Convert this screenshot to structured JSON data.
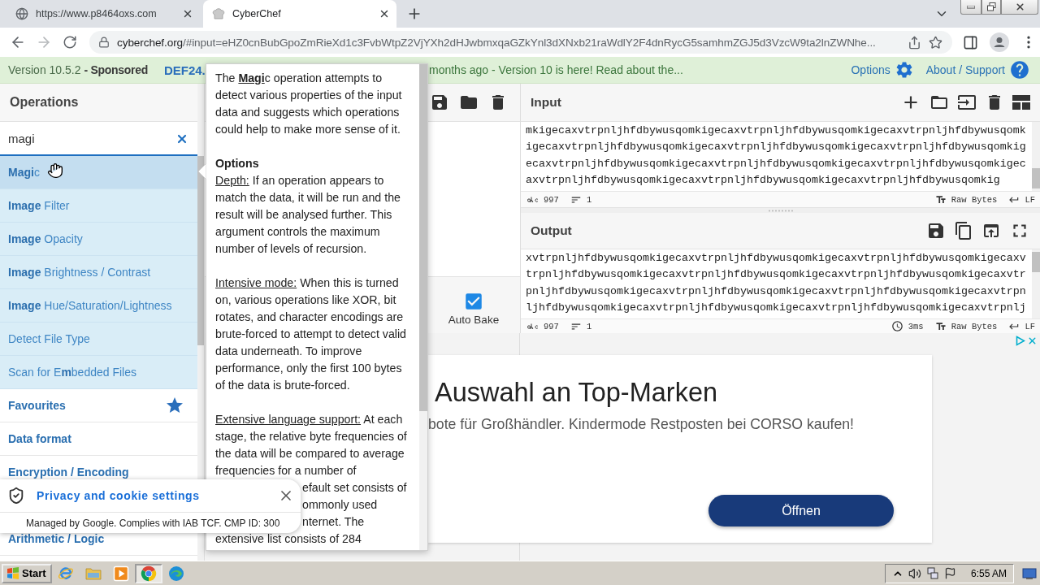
{
  "browser": {
    "tabs": [
      {
        "title": "https://www.p8464oxs.com",
        "selected": false
      },
      {
        "title": "CyberChef",
        "selected": true
      }
    ],
    "address": {
      "host": "cyberchef.org",
      "path": "/#input=eHZ0cnBubGpoZmRieXd1c3FvbWtpZ2VjYXh2dHJwbmxqaGZkYnl3dXNxb21raWdlY2F4dnRycG5samhmZGJ5d3VzcW9ta2lnZWNhe..."
    }
  },
  "banner": {
    "version": "Version 10.5.2",
    "sponsored": "- Sponsored",
    "sponsor": "DEF24.",
    "news": "months ago - Version 10 is here! Read about the...",
    "options": "Options",
    "support": "About / Support"
  },
  "operations": {
    "title": "Operations",
    "search": {
      "value": "magi"
    },
    "results": [
      {
        "label": "**Magi**c",
        "selected": true
      },
      {
        "label": "**Image** Filter",
        "selected": false
      },
      {
        "label": "**Image** Opacity",
        "selected": false
      },
      {
        "label": "**Image** Brightness / Contrast",
        "selected": false
      },
      {
        "label": "**Image** Hue/Saturation/Lightness",
        "selected": false
      },
      {
        "label": "Detect File Type",
        "selected": false
      },
      {
        "label": "Scan for E**m**bedded Files",
        "selected": false
      }
    ],
    "categories": [
      {
        "label": "Favourites",
        "kind": "favourites"
      },
      {
        "label": "Data format",
        "kind": "category"
      },
      {
        "label": "Encryption / Encoding",
        "kind": "category"
      }
    ],
    "categories_below_banner": [
      {
        "label": "Arithmetic / Logic"
      }
    ]
  },
  "recipe": {
    "auto_bake": {
      "label": "Auto Bake",
      "checked": true
    }
  },
  "input": {
    "title": "Input",
    "lines": [
      "mkigecaxvtrpnljhfdbywusqomkigecaxvtrpnljhfdbywusqomkigecaxvtrpnljhfdbywusqomk",
      "igecaxvtrpnljhfdbywusqomkigecaxvtrpnljhfdbywusqomkigecaxvtrpnljhfdbywusqomkig",
      "ecaxvtrpnljhfdbywusqomkigecaxvtrpnljhfdbywusqomkigecaxvtrpnljhfdbywusqomkigec",
      "axvtrpnljhfdbywusqomkigecaxvtrpnljhfdbywusqomkigecaxvtrpnljhfdbywusqomkig"
    ],
    "status": {
      "length": "997",
      "lines": "1",
      "format": "Raw Bytes",
      "eol": "LF"
    }
  },
  "output": {
    "title": "Output",
    "lines": [
      "xvtrpnljhfdbywusqomkigecaxvtrpnljhfdbywusqomkigecaxvtrpnljhfdbywusqomkigecaxv",
      "trpnljhfdbywusqomkigecaxvtrpnljhfdbywusqomkigecaxvtrpnljhfdbywusqomkigecaxvtr",
      "pnljhfdbywusqomkigecaxvtrpnljhfdbywusqomkigecaxvtrpnljhfdbywusqomkigecaxvtrpn",
      "ljhfdbywusqomkigecaxvtrpnljhfdbywusqomkigecaxvtrpnljhfdbywusqomkigecaxvtrpnlj"
    ],
    "status": {
      "length": "997",
      "lines": "1",
      "time": "3ms",
      "format": "Raw Bytes",
      "eol": "LF"
    }
  },
  "popover": {
    "intro": "The **Magi**c operation attempts to detect various properties of the input data and suggests which operations could help to make more sense of it.",
    "heading": "Options",
    "options": [
      {
        "term": "Depth:",
        "text": "If an operation appears to match the data, it will be run and the result will be analysed further. This argument controls the maximum number of levels of recursion."
      },
      {
        "term": "Intensive mode:",
        "text": "When this is turned on, various operations like XOR, bit rotates, and character encodings are brute-forced to attempt to detect valid data underneath. To improve performance, only the first 100 bytes of the data is brute-forced."
      },
      {
        "term": "Extensive language support:",
        "text": "At each stage, the relative byte frequencies of the data will be compared to average frequencies for a number of"
      }
    ],
    "covered_lines": [
      "efault set consists of",
      "ommonly used",
      "nternet. The"
    ],
    "last_line": "extensive list consists of 284"
  },
  "ad": {
    "heading": "Auswahl an Top-Marken",
    "text": "bote für Großhändler. Kindermode Restposten bei CORSO kaufen!",
    "button": "Öffnen"
  },
  "privacy": {
    "title": "Privacy and cookie settings",
    "note": "Managed by Google. Complies with IAB TCF. CMP ID: 300"
  },
  "taskbar": {
    "start": "Start",
    "apps": [
      {
        "kind": "ie",
        "selected": false
      },
      {
        "kind": "explorer",
        "selected": false
      },
      {
        "kind": "player",
        "selected": false
      },
      {
        "kind": "chrome",
        "selected": true
      },
      {
        "kind": "edge",
        "selected": false
      }
    ],
    "time": "6:55 AM"
  }
}
